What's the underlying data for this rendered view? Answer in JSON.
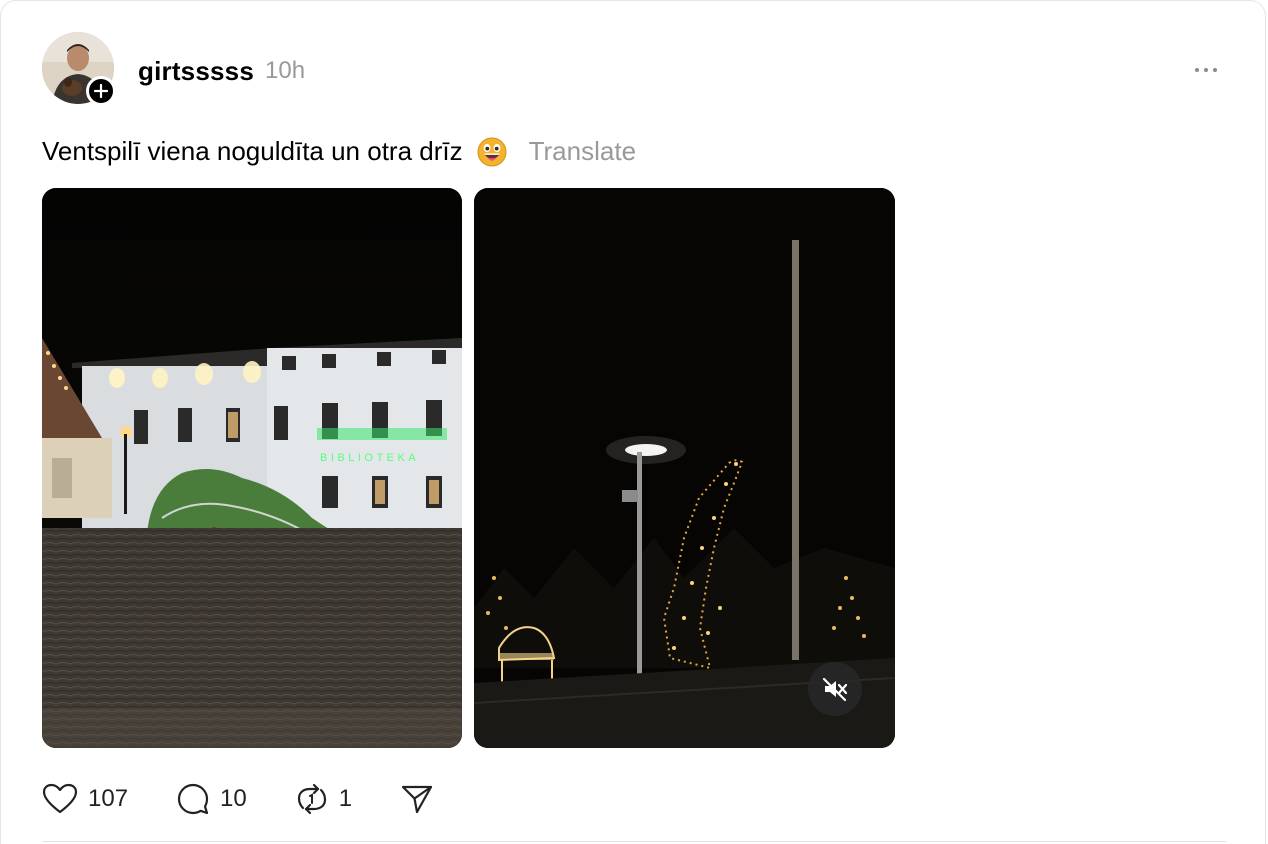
{
  "post": {
    "username": "girtsssss",
    "timestamp": "10h",
    "text": "Ventspilī viena noguldīta un otra drīz",
    "emoji": "grinning-face-with-tongue",
    "translate_label": "Translate",
    "image1_sign": "BIBLIOTEKA"
  },
  "actions": {
    "likes": "107",
    "replies": "10",
    "reposts": "1"
  },
  "icons": {
    "more": "ellipsis-icon",
    "follow": "plus-icon",
    "like": "heart-icon",
    "reply": "speech-bubble-icon",
    "repost": "repost-icon",
    "share": "send-icon",
    "mute": "speaker-muted-icon"
  },
  "colors": {
    "text": "#000000",
    "muted": "#999999",
    "divider": "#e2e2e2"
  }
}
